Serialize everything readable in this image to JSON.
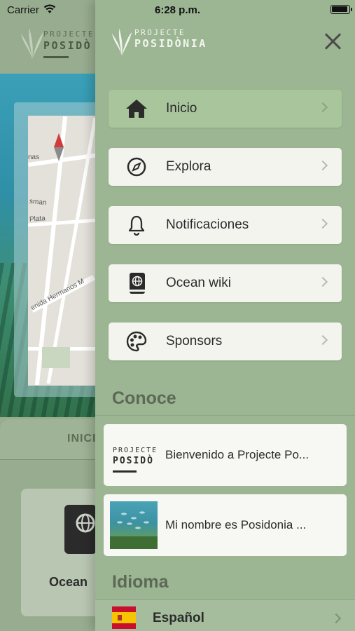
{
  "status_bar": {
    "carrier": "Carrier",
    "time": "6:28 p.m."
  },
  "logo": {
    "line1": "PROJECTE",
    "line2": "POSIDÒNIA"
  },
  "background_app": {
    "logo_line1": "PROJECTE",
    "logo_line2": "POSIDÒ",
    "tab_label": "INICI",
    "card_label": "Ocean",
    "map_labels": [
      "nas",
      "sman",
      "Plata",
      "enida Hermanos M"
    ]
  },
  "menu": {
    "items": [
      {
        "label": "Inicio",
        "icon": "home-icon",
        "active": true
      },
      {
        "label": "Explora",
        "icon": "compass-icon",
        "active": false
      },
      {
        "label": "Notificaciones",
        "icon": "bell-icon",
        "active": false
      },
      {
        "label": "Ocean wiki",
        "icon": "book-globe-icon",
        "active": false
      },
      {
        "label": "Sponsors",
        "icon": "sponsor-icon",
        "active": false
      }
    ]
  },
  "conoce": {
    "title": "Conoce",
    "posts": [
      {
        "title": "Bienvenido a Projecte Po...",
        "thumb_line1": "PROJECTE",
        "thumb_line2": "POSIDÒ"
      },
      {
        "title": "Mi nombre es Posidonia ...",
        "thumb": "underwater-photo"
      }
    ]
  },
  "idioma": {
    "title": "Idioma",
    "selected": "Español",
    "flag": "spain-flag-icon"
  },
  "colors": {
    "drawer_bg": "#9cb593",
    "active_item": "#a9c59c",
    "card_bg": "#f4f4ef",
    "section_title": "#5c6a55"
  }
}
